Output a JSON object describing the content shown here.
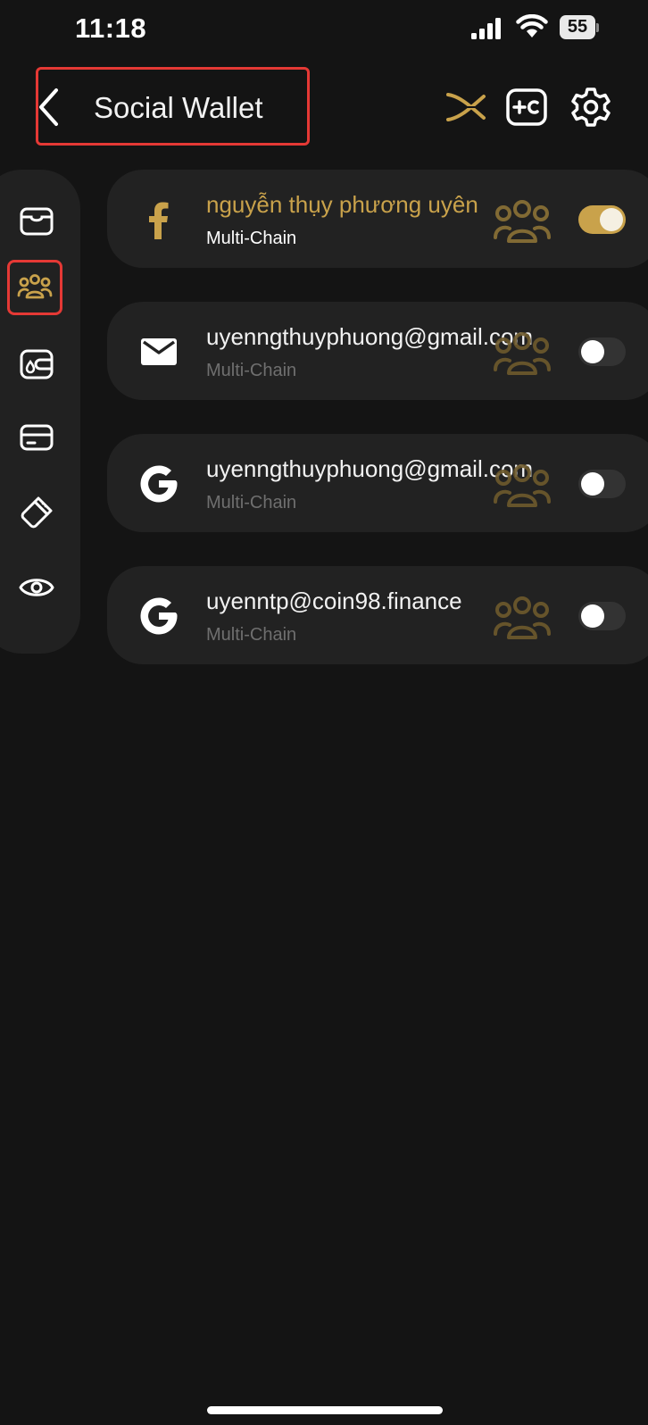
{
  "status_bar": {
    "time": "11:18",
    "battery": "55"
  },
  "header": {
    "title": "Social Wallet"
  },
  "colors": {
    "accent": "#c9a24b",
    "background": "#141414",
    "card": "#222222",
    "highlight": "#e53935"
  },
  "sidebar": {
    "items": [
      {
        "icon": "wallet-icon"
      },
      {
        "icon": "social-group-icon",
        "active": true
      },
      {
        "icon": "wallet-drop-icon"
      },
      {
        "icon": "card-icon"
      },
      {
        "icon": "usb-key-icon"
      },
      {
        "icon": "eye-icon"
      }
    ]
  },
  "wallets": [
    {
      "provider": "facebook-icon",
      "name": "nguyễn thụy phương uyên",
      "sub": "Multi-Chain",
      "enabled": true
    },
    {
      "provider": "mail-icon",
      "name": "uyenngthuyphuong@gmail.com",
      "sub": "Multi-Chain",
      "enabled": false
    },
    {
      "provider": "google-icon",
      "name": "uyenngthuyphuong@gmail.com",
      "sub": "Multi-Chain",
      "enabled": false
    },
    {
      "provider": "google-icon",
      "name": "uyenntp@coin98.finance",
      "sub": "Multi-Chain",
      "enabled": false
    }
  ]
}
